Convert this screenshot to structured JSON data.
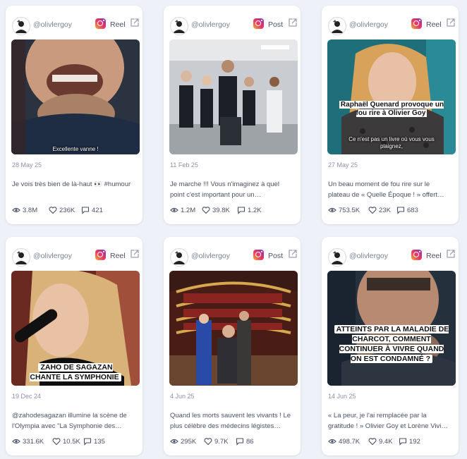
{
  "cards": [
    {
      "username": "@olivlergoy",
      "type": "Reel",
      "date": "28 May 25",
      "caption": "Je vois très bien de là-haut 👀 #humour",
      "views": "3.8M",
      "likes": "236K",
      "comments": "421",
      "overlay": "Excellente vanne !"
    },
    {
      "username": "@olivlergoy",
      "type": "Post",
      "date": "11 Feb 25",
      "caption": "Je marche !!! Vous n'imaginez à quel point c'est important pour un…",
      "views": "1.2M",
      "likes": "39.8K",
      "comments": "1.2K"
    },
    {
      "username": "@olivlergoy",
      "type": "Reel",
      "date": "27 May 25",
      "caption": "Un beau moment de fou rire sur le plateau de « Quelle Époque ! » offert…",
      "views": "753.5K",
      "likes": "23K",
      "comments": "683",
      "overlay_top": "Raphaël Quenard provoque un fou rire à Olivier Goy",
      "overlay": "Ce n'est pas un livre où vous vous plaignez,"
    },
    {
      "username": "@olivlergoy",
      "type": "Reel",
      "date": "19 Dec 24",
      "caption": "@zahodesagazan illumine la scène de l'Olympia avec \"La Symphonie des…",
      "views": "331.6K",
      "likes": "10.5K",
      "comments": "135",
      "overlay": "ZAHO DE SAGAZAN CHANTE LA SYMPHONIE"
    },
    {
      "username": "@olivlergoy",
      "type": "Post",
      "date": "4 Jun 25",
      "caption": "Quand les morts sauvent les vivants ! Le plus célèbre des médecins légistes…",
      "views": "295K",
      "likes": "9.7K",
      "comments": "86"
    },
    {
      "username": "@olivlergoy",
      "type": "Reel",
      "date": "14 Jun 25",
      "caption": "« La peur, je l'ai remplacée par la gratitude ! » Olivier Goy et Lorène Vivi…",
      "views": "498.7K",
      "likes": "9.4K",
      "comments": "192",
      "overlay": "ATTEINTS PAR LA MALADIE DE CHARCOT, COMMENT CONTINUER À VIVRE QUAND ON EST CONDAMNÉ ?"
    }
  ],
  "icons": {
    "avatar": "avatar-icon",
    "platform": "instagram-icon",
    "external": "external-link-icon",
    "views": "eye-icon",
    "likes": "heart-icon",
    "comments": "comment-icon"
  },
  "colors": {
    "background": "#eef1f7",
    "card": "#ffffff",
    "text": "#4a5166",
    "muted": "#8a91a3"
  }
}
